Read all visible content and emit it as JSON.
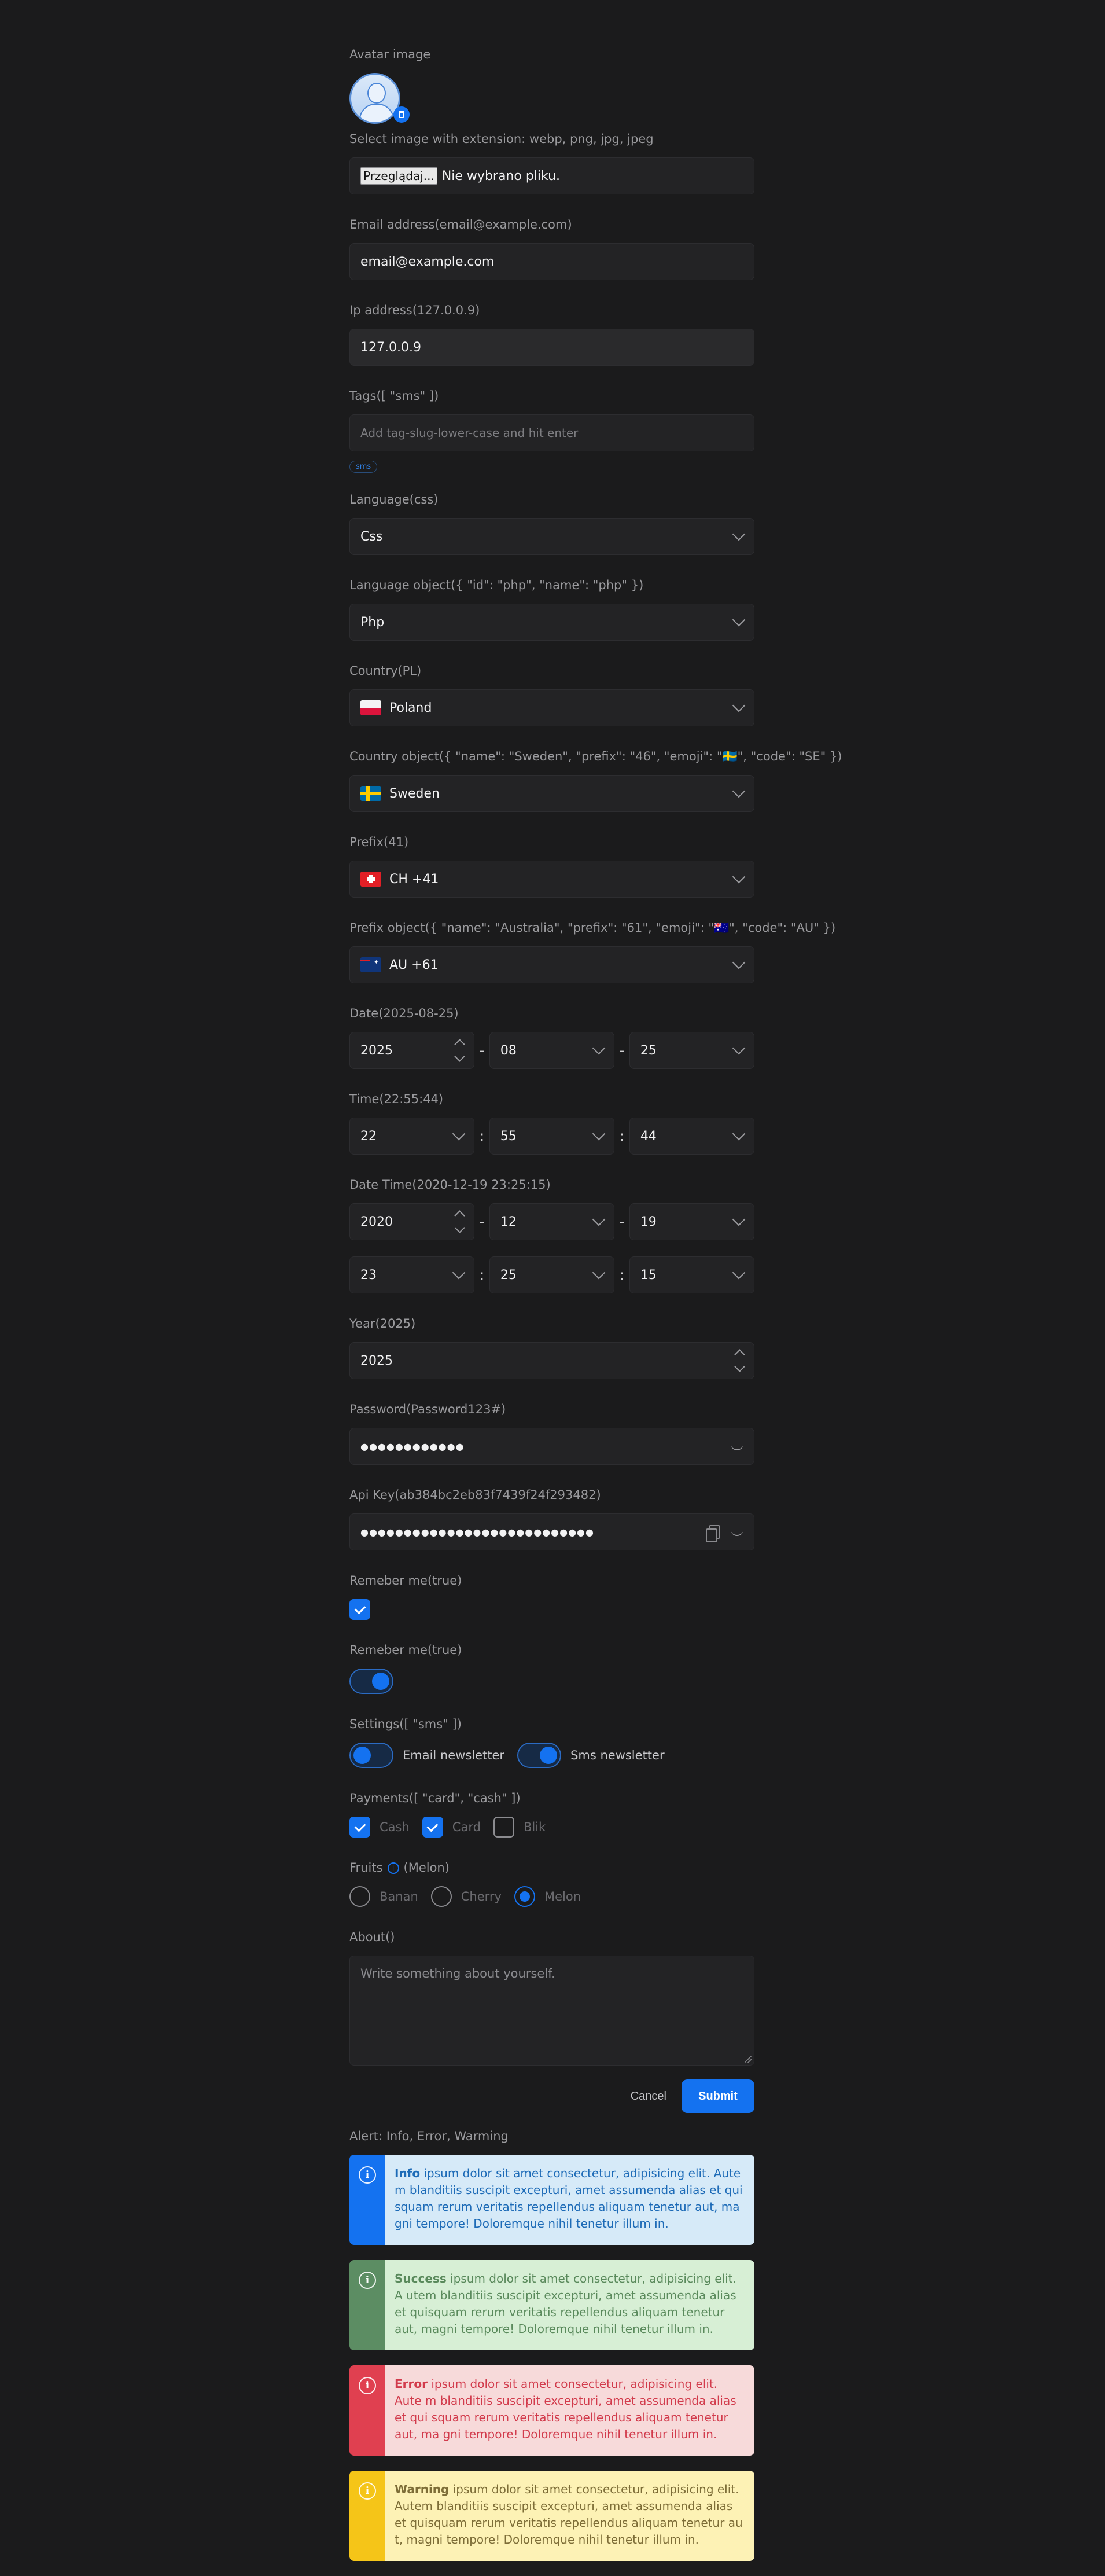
{
  "avatar": {
    "label": "Avatar image",
    "hint": "Select image with extension: webp, png, jpg, jpeg"
  },
  "file": {
    "button": "Przeglądaj...",
    "status": "Nie wybrano pliku."
  },
  "email": {
    "label": "Email address(email@example.com)",
    "value": "email@example.com"
  },
  "ip": {
    "label": "Ip address(127.0.0.9)",
    "value": "127.0.0.9"
  },
  "tags": {
    "label": "Tags([ \"sms\" ])",
    "placeholder": "Add tag-slug-lower-case and hit enter",
    "chip": "sms"
  },
  "language": {
    "label": "Language(css)",
    "value": "Css"
  },
  "language_object": {
    "label": "Language object({ \"id\": \"php\", \"name\": \"php\" })",
    "value": "Php"
  },
  "country": {
    "label": "Country(PL)",
    "value": "Poland"
  },
  "country_object": {
    "label": "Country object({ \"name\": \"Sweden\", \"prefix\": \"46\", \"emoji\": \"🇸🇪\", \"code\": \"SE\" })",
    "value": "Sweden"
  },
  "prefix": {
    "label": "Prefix(41)",
    "value": "CH +41"
  },
  "prefix_object": {
    "label": "Prefix object({ \"name\": \"Australia\", \"prefix\": \"61\", \"emoji\": \"🇦🇺\", \"code\": \"AU\" })",
    "value": "AU +61"
  },
  "date": {
    "label": "Date(2025-08-25)",
    "year": "2025",
    "month": "08",
    "day": "25",
    "sep": "-"
  },
  "time": {
    "label": "Time(22:55:44)",
    "hour": "22",
    "minute": "55",
    "second": "44",
    "sep": ":"
  },
  "datetime": {
    "label": "Date Time(2020-12-19 23:25:15)",
    "year": "2020",
    "month": "12",
    "day": "19",
    "hour": "23",
    "minute": "25",
    "second": "15"
  },
  "year": {
    "label": "Year(2025)",
    "value": "2025"
  },
  "password": {
    "label": "Password(Password123#)",
    "value": "●●●●●●●●●●●●"
  },
  "apikey": {
    "label": "Api Key(ab384bc2eb83f7439f24f293482)",
    "value": "●●●●●●●●●●●●●●●●●●●●●●●●●●●"
  },
  "remember_checkbox": {
    "label": "Remeber me(true)"
  },
  "remember_toggle": {
    "label": "Remeber me(true)"
  },
  "settings": {
    "label": "Settings([ \"sms\" ])",
    "email": "Email newsletter",
    "sms": "Sms newsletter"
  },
  "payments": {
    "label": "Payments([ \"card\", \"cash\" ])",
    "cash": "Cash",
    "card": "Card",
    "blik": "Blik"
  },
  "fruits": {
    "label": "Fruits",
    "value_note": "(Melon)",
    "banan": "Banan",
    "cherry": "Cherry",
    "melon": "Melon"
  },
  "about": {
    "label": "About()",
    "placeholder": "Write something about yourself."
  },
  "actions": {
    "cancel": "Cancel",
    "submit": "Submit"
  },
  "alerts": {
    "label": "Alert: Info, Error, Warming",
    "info": {
      "title": "Info",
      "text": " ipsum dolor sit amet consectetur, adipisicing elit. Aute m blanditiis suscipit excepturi, amet assumenda alias et qui squam rerum veritatis repellendus aliquam tenetur aut, ma gni tempore! Doloremque nihil tenetur illum in."
    },
    "success": {
      "title": "Success",
      "text": " ipsum dolor sit amet consectetur, adipisicing elit. A utem blanditiis suscipit excepturi, amet assumenda alias et quisquam rerum veritatis repellendus aliquam tenetur aut, magni tempore! Doloremque nihil tenetur illum in."
    },
    "error": {
      "title": "Error",
      "text": " ipsum dolor sit amet consectetur, adipisicing elit. Aute m blanditiis suscipit excepturi, amet assumenda alias et qui squam rerum veritatis repellendus aliquam tenetur aut, ma gni tempore! Doloremque nihil tenetur illum in."
    },
    "warning": {
      "title": "Warning",
      "text": " ipsum dolor sit amet consectetur, adipisicing elit. Autem blanditiis suscipit excepturi, amet assumenda alias et quisquam rerum veritatis repellendus aliquam tenetur au t, magni tempore! Doloremque nihil tenetur illum in."
    }
  },
  "icons": {
    "info": "i"
  },
  "colors": {
    "accent": "#1472f0",
    "background": "#1b1b1c",
    "field": "#232325"
  }
}
